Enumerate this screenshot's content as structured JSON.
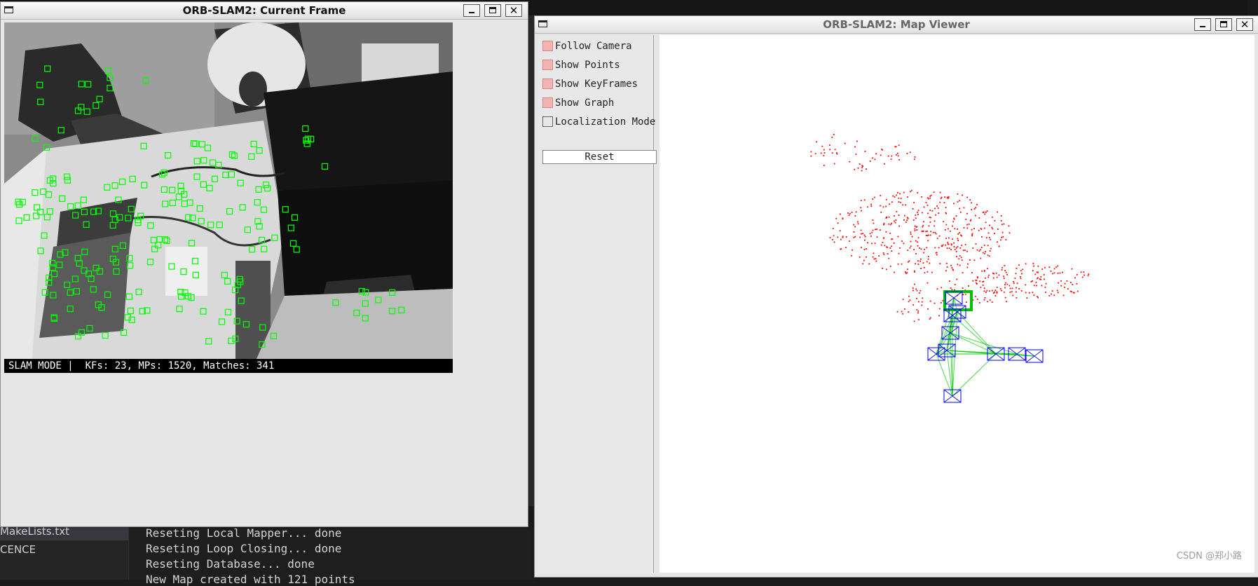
{
  "background": {
    "ide_files": [
      {
        "label": "MakeLists.txt",
        "active": true
      },
      {
        "label": "CENCE",
        "active": false
      }
    ],
    "terminal_lines": [
      "Reseting Local Mapper... done",
      "Reseting Loop Closing... done",
      "Reseting Database... done",
      "New Map created with 121 points"
    ]
  },
  "current_frame_window": {
    "title": "ORB-SLAM2: Current Frame",
    "status_text": "SLAM MODE |  KFs: 23, MPs: 1520, Matches: 341",
    "feature_color": "#00ff00"
  },
  "map_viewer_window": {
    "title": "ORB-SLAM2: Map Viewer",
    "options": [
      {
        "label": "Follow Camera",
        "checked": true
      },
      {
        "label": "Show Points",
        "checked": true
      },
      {
        "label": "Show KeyFrames",
        "checked": true
      },
      {
        "label": "Show Graph",
        "checked": true
      },
      {
        "label": "Localization Mode",
        "checked": false
      }
    ],
    "reset_label": "Reset",
    "map_point_color": "#ff0000",
    "keyframe_color": "#0000ff",
    "graph_color": "#00c800"
  },
  "watermark": "CSDN @郑小路"
}
